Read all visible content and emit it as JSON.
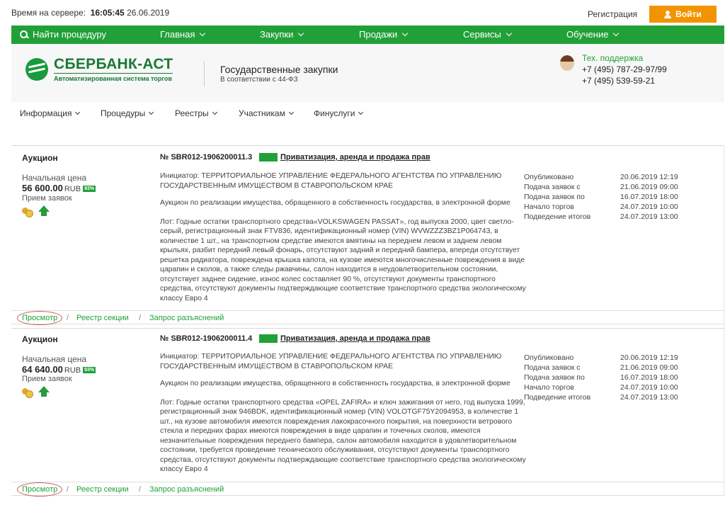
{
  "topbar": {
    "server_time_label": "Время на сервере:",
    "server_time": "16:05:45",
    "server_date": "26.06.2019",
    "register_label": "Регистрация",
    "login_label": "Войти"
  },
  "greennav": {
    "search_label": "Найти процедуру",
    "items": [
      "Главная",
      "Закупки",
      "Продажи",
      "Сервисы",
      "Обучение"
    ]
  },
  "header": {
    "logo_title": "СБЕРБАНК-АСТ",
    "logo_subtitle": "Автоматизированная система торгов",
    "section_title": "Государственные закупки",
    "section_subtitle": "В соответствии с 44-ФЗ",
    "support_title": "Тех. поддержка",
    "support_phone1": "+7 (495) 787-29-97/99",
    "support_phone2": "+7 (495) 539-59-21"
  },
  "subnav": {
    "items": [
      "Информация",
      "Процедуры",
      "Реестры",
      "Участникам",
      "Финуслуги"
    ]
  },
  "colors": {
    "green": "#21a038",
    "orange": "#f29400"
  },
  "cards": [
    {
      "type": "Аукцион",
      "number": "№ SBR012-1906200011.3",
      "category": "Приватизация, аренда и продажа прав",
      "price_label": "Начальная цена",
      "price": "56 600.00",
      "currency": "RUB",
      "pct": "93%",
      "accept_label": "Прием заявок",
      "organizer": "Инициатор: ТЕРРИТОРИАЛЬНОЕ УПРАВЛЕНИЕ ФЕДЕРАЛЬНОГО АГЕНТСТВА ПО УПРАВЛЕНИЮ ГОСУДАРСТВЕННЫМ ИМУЩЕСТВОМ В СТАВРОПОЛЬСКОМ КРАЕ",
      "description": "Аукцион по реализации имущества, обращенного в собственность государства, в электронной форме",
      "lot": "Лот: Годные остатки транспортного средства«VOLKSWAGEN PASSAT», год выпуска 2000, цвет светло-серый, регистрационный знак FTV836, идентификационный номер (VIN) WVWZZZ3BZ1P064743, в количестве 1 шт., на транспортном средстве имеются вмятины на переднем левом и заднем левом крыльях, разбит передний левый фонарь, отсутствуют задний и передний бампера, впереди отсутствует решетка радиатора, повреждена крышка капота, на кузове имеются многочисленные повреждения в виде царапин и сколов, а также следы ржавчины, салон находится в неудовлетворительном состоянии, отсутствует заднее сидение, износ колес составляет 90 %, отсутствуют документы транспортного средства, отсутствуют документы подтверждающие соответствие транспортного средства экологическому классу Евро 4",
      "dates": [
        {
          "label": "Опубликовано",
          "value": "20.06.2019 12:19"
        },
        {
          "label": "Подача заявок с",
          "value": "21.06.2019 09:00"
        },
        {
          "label": "Подача заявок по",
          "value": "16.07.2019 18:00"
        },
        {
          "label": "Начало торгов",
          "value": "24.07.2019 10:00"
        },
        {
          "label": "Подведение итогов",
          "value": "24.07.2019 13:00"
        }
      ],
      "links": [
        "Просмотр",
        "Реестр секции",
        "Запрос разъяснений"
      ],
      "sep": "/"
    },
    {
      "type": "Аукцион",
      "number": "№ SBR012-1906200011.4",
      "category": "Приватизация, аренда и продажа прав",
      "price_label": "Начальная цена",
      "price": "64 640.00",
      "currency": "RUB",
      "pct": "93%",
      "accept_label": "Прием заявок",
      "organizer": "Инициатор: ТЕРРИТОРИАЛЬНОЕ УПРАВЛЕНИЕ ФЕДЕРАЛЬНОГО АГЕНТСТВА ПО УПРАВЛЕНИЮ ГОСУДАРСТВЕННЫМ ИМУЩЕСТВОМ В СТАВРОПОЛЬСКОМ КРАЕ",
      "description": "Аукцион по реализации имущества, обращенного в собственность государства, в электронной форме",
      "lot": "Лот: Годные остатки транспортного средства «OPEL ZAFIRA» и ключ зажигания от него, год выпуска 1999, регистрационный знак 946BDK, идентификационный номер (VIN) VOLOTGF75Y2094953, в количестве 1 шт., на кузове автомобиля имеются повреждения лакокрасочного покрытия, на поверхности ветрового стекла и передних фарах имеются повреждения в виде царапин и точечных сколов, имеются незначительные повреждения переднего бампера, салон автомобиля находится в удовлетворительном состоянии, требуется проведение технического обслуживания, отсутствуют документы транспортного средства, отсутствуют документы подтверждающие соответствие транспортного средства экологическому классу Евро 4",
      "dates": [
        {
          "label": "Опубликовано",
          "value": "20.06.2019 12:19"
        },
        {
          "label": "Подача заявок с",
          "value": "21.06.2019 09:00"
        },
        {
          "label": "Подача заявок по",
          "value": "16.07.2019 18:00"
        },
        {
          "label": "Начало торгов",
          "value": "24.07.2019 10:00"
        },
        {
          "label": "Подведение итогов",
          "value": "24.07.2019 13:00"
        }
      ],
      "links": [
        "Просмотр",
        "Реестр секции",
        "Запрос разъяснений"
      ],
      "sep": "/"
    }
  ]
}
